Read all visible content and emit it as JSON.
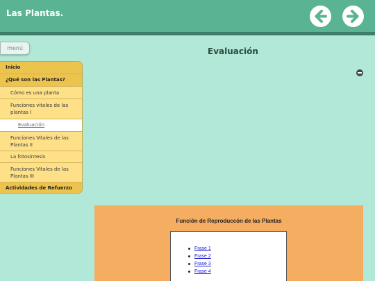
{
  "header": {
    "title": "Las Plantas.",
    "prev_icon": "arrow-left-icon",
    "next_icon": "arrow-right-icon"
  },
  "menu_button": {
    "label": "menú"
  },
  "sidebar": {
    "items": [
      {
        "label": "Inicio"
      },
      {
        "label": "¿Qué son las Plantas?"
      },
      {
        "label": "Cómo es una planta"
      },
      {
        "label": "Funciones vitales de las plantas I"
      },
      {
        "label": "Evaluación"
      },
      {
        "label": "Funciones Vitales de las Plantas II"
      },
      {
        "label": "La fotosíntesis"
      },
      {
        "label": "Funciones Vitales de las Plantas III"
      },
      {
        "label": "Actividades de Refuerzo"
      }
    ]
  },
  "main": {
    "title": "Evaluación",
    "collapse_icon": "minus-circle-icon"
  },
  "activity": {
    "title": "Función de Reproduccón de las Plantas",
    "links": [
      "Frase 1",
      "Frase 2",
      "Frase 3",
      "Frase 4"
    ]
  },
  "colors": {
    "header": "#5ab393",
    "background": "#b1e8d8",
    "sidebar": "#fde087",
    "sidebar_heading": "#ecc34d",
    "activity": "#f5ad62"
  }
}
